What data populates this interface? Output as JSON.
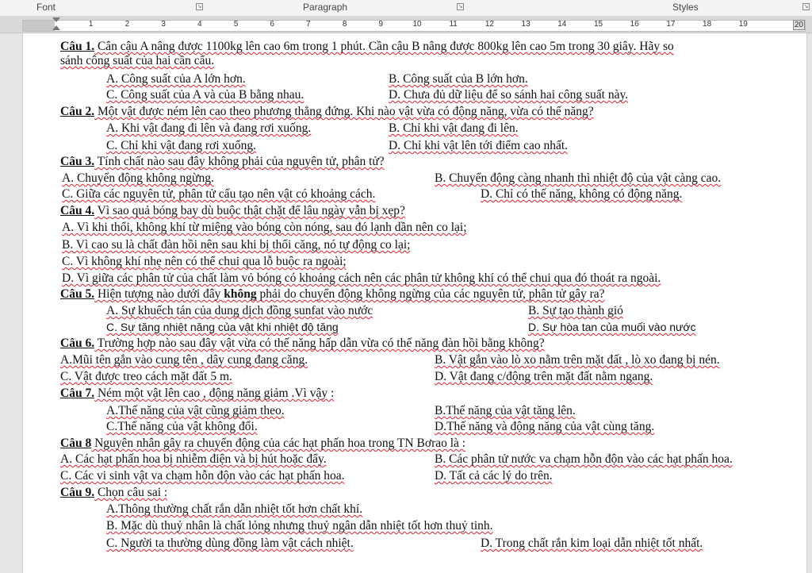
{
  "ribbon": {
    "font": "Font",
    "paragraph": "Paragraph",
    "styles": "Styles"
  },
  "ruler": {
    "ticks": [
      "1",
      "2",
      "3",
      "4",
      "5",
      "6",
      "7",
      "8",
      "9",
      "10",
      "11",
      "12",
      "13",
      "14",
      "15",
      "16",
      "17",
      "18",
      "19"
    ],
    "end": "20"
  },
  "q1": {
    "label": "Câu 1.",
    "text": " Cân cậu A nâng được 1100kg lên cao 6m trong 1 phút. Cần cậu B nâng được 800kg  lên cao 5m trong 30 giây. Hãy so",
    "cont": "sánh công suất của hai cần cẩu.",
    "a": "A. Công suất của A lớn hơn.",
    "b": "B. Công suất của B lớn hơn.",
    "c": "C. Công suất của A và của B bằng nhau.",
    "d": "D. Chưa đủ dữ liệu để so sánh  hai công suất này."
  },
  "q2": {
    "label": "Câu 2.",
    "text": " Một vật được ném lên cao theo phương thẳng đứng. Khi nào vật vừa có động năng, vừa có thế năng?",
    "a": "A. Khi vật đang đi lên và đang rơi xuống.",
    "b": "B. Chỉ khi vật đang đi lên.",
    "c": "C. Chỉ khi vật đang rơi xuống.",
    "d": "D. Chỉ khi vật lên tới điểm cao nhất."
  },
  "q3": {
    "label": "Câu 3.",
    "text": " Tính chất nào sau đây không phải của nguyên tử, phân tử?",
    "a": "A. Chuyển động không ngừng.",
    "b": "B. Chuyển động càng nhanh thì nhiệt độ của vật càng cao.",
    "c": "C. Giữa các nguyên tử, phân tử cấu tạo nên vật có khoảng cách.",
    "d": "D. Chỉ có thế năng, không có động năng."
  },
  "q4": {
    "label": "Câu 4.",
    "text": " Vì sao quả bóng bay dù buộc thật chặt để lâu ngày vẫn bị xẹp?",
    "a": "A. Vì khi thổi, không khí từ miệng vào bóng còn nóng, sau đó lạnh dần nên co lại;",
    "b": "B. Vì cao su là chất đàn hồi nên sau khi bị thổi căng, nó tự động co lại;",
    "c": "C. Vì không khí nhẹ nên có thể chui qua lỗ buộc ra ngoài;",
    "d": "D. Vì giữa các phân tử của chất làm vỏ bóng có khoảng cách nên các phân tử không khí có thể chui qua đó thoát ra ngoài."
  },
  "q5": {
    "label": "Câu 5.",
    "text_pre": " Hiện tượng nào dưới đây ",
    "text_bold": "không",
    "text_post": " phải do chuyển động không ngừng của các nguyên tử, phân tử gây ra?",
    "a": "A. Sự khuếch tán của dung dịch đồng sunfat vào nước",
    "b": "B. Sự tạo thành gió",
    "c": "C. Sự tăng nhiệt năng của vật khi nhiệt độ tăng",
    "d": "D. Sự hòa tan của muối vào nước"
  },
  "q6": {
    "label": "Câu 6.",
    "text": " Trường hợp nào sau đây vật vừa có thế năng hấp dẫn vừa có thế năng đàn hồi bằng không?",
    "a": "A.Mũi tên gắn vào cung tên , dây cung đang căng.",
    "b": "B. Vật gắn vào lò xo nằm trên mặt đất , lò xo đang bị nén.",
    "c": "C. Vật được treo cách mặt đất 5 m.",
    "d": "D. Vật đang c/động trên mặt đất nằm ngang."
  },
  "q7": {
    "label": "Câu 7.",
    "text": "  Ném một vật lên cao , động năng giảm .Vì vậy :",
    "a": "A.Thế năng của vật cũng giảm theo.",
    "b": "B.Thế năng của vật tăng lên.",
    "c": "C.Thế năng của vật không đổi.",
    "d": "D.Thế năng và động năng của vật cùng tăng."
  },
  "q8": {
    "label": "Câu 8",
    "text": " Nguyên nhân gây ra chuyển động của các hạt phấn hoa trong TN Bơrao là :",
    "a": "A. Các hạt phấn hoa bị nhiễm điện và bị hút hoặc đẩy.",
    "b": "B. Các phân tử nước va chạm hỗn độn vào các hạt phấn hoa.",
    "c": "C. Các vi sinh vật va chạm hỗn độn vào các hạt phấn hoa.",
    "d": "D. Tất cả các lý do trên."
  },
  "q9": {
    "label": "Câu 9.",
    "text": "  Chọn câu sai :",
    "a": "A.Thông thường chất rắn dẫn nhiệt tốt hơn chất khí.",
    "b": "B. Mặc dù thuỷ nhân là chất lỏng nhưng thuỷ ngân dẫn nhiệt tốt hơn thuỷ tinh.",
    "c": "C. Người ta thường dùng đồng làm vật cách nhiệt.",
    "d": "D. Trong chất rắn kim loại dẫn nhiệt tốt nhất."
  }
}
